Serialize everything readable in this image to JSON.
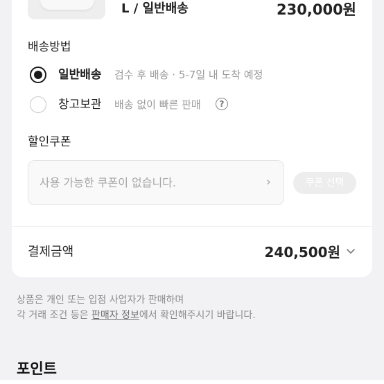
{
  "product": {
    "option": "L / 일반배송",
    "price": "230,000원"
  },
  "shipping": {
    "title": "배송방법",
    "options": [
      {
        "label": "일반배송",
        "description": "검수 후 배송 · 5-7일 내 도착 예정",
        "selected": true
      },
      {
        "label": "창고보관",
        "description": "배송 없이 빠른 판매",
        "selected": false,
        "help_icon": "question-circle-icon"
      }
    ]
  },
  "coupon": {
    "title": "할인쿠폰",
    "placeholder": "사용 가능한 쿠폰이 없습니다.",
    "select_label": "쿠폰 선택"
  },
  "payment": {
    "label": "결제금액",
    "amount": "240,500원"
  },
  "notice": {
    "line1": "상품은 개인 또는 입점 사업자가 판매하며",
    "line2_prefix": "각 거래 조건 등은 ",
    "line2_link": "판매자 정보",
    "line2_suffix": "에서 확인해주시기 바랍니다."
  },
  "points": {
    "title": "포인트"
  },
  "colors": {
    "background": "#f2f2f4",
    "card": "#ffffff",
    "text": "#222222",
    "muted": "#9a9a9a",
    "disabled_button": "#ededed"
  }
}
